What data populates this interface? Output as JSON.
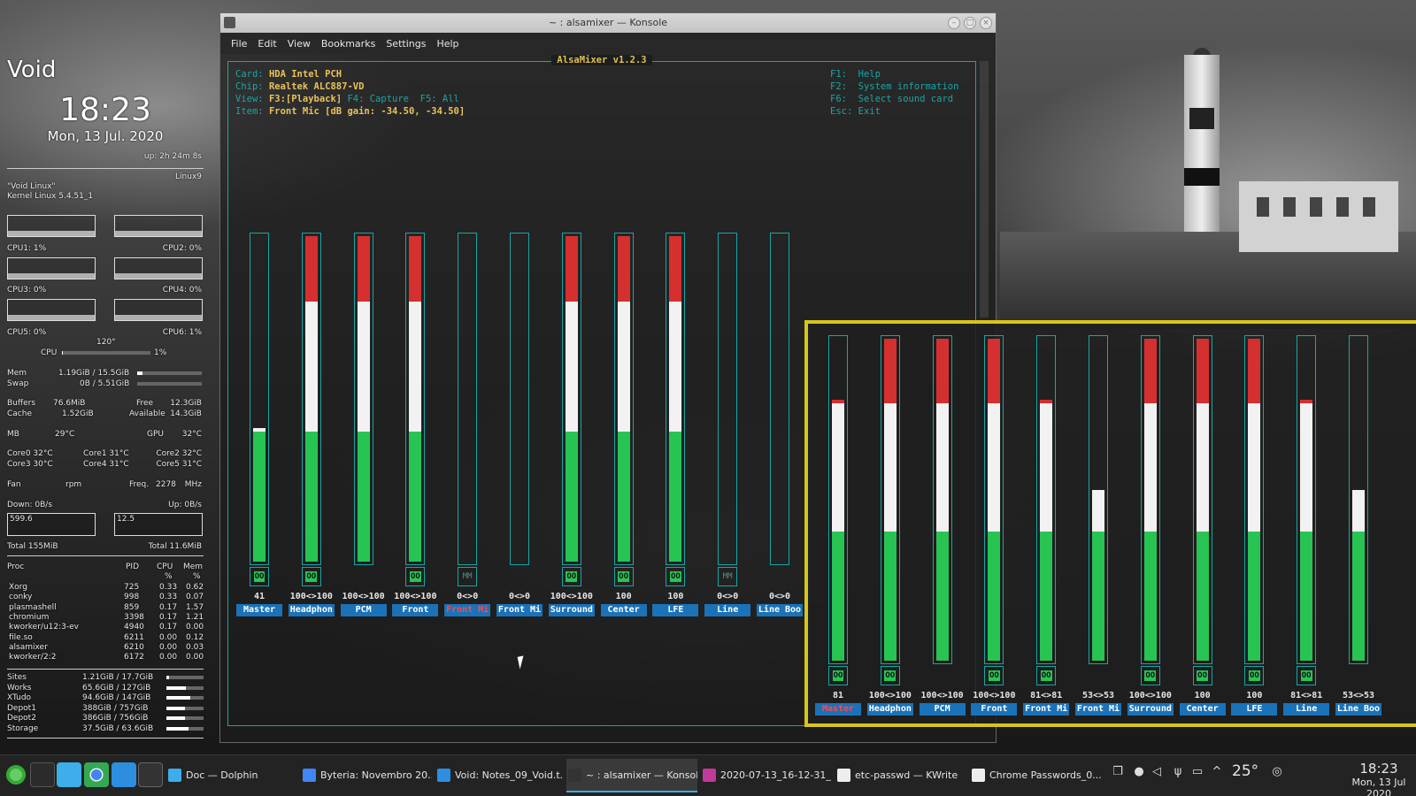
{
  "conky": {
    "hostname": "Void",
    "time": "18:23",
    "date": "Mon, 13 Jul. 2020",
    "uptime": "up: 2h 24m 8s",
    "kernel_short": "Linux9",
    "os": "\"Void Linux\"",
    "kernel": "Kernel Linux 5.4.51_1",
    "cpus": [
      {
        "label": "CPU1: 1%"
      },
      {
        "label": "CPU2: 0%"
      },
      {
        "label": "CPU3: 0%"
      },
      {
        "label": "CPU4: 0%"
      },
      {
        "label": "CPU5: 0%"
      },
      {
        "label": "CPU6: 1%"
      }
    ],
    "cpu_temp": "120°",
    "cpu_label": "CPU",
    "cpu_total": "1%",
    "cpu_total_fraction": 0.01,
    "mem_label": "Mem",
    "mem_value": "1.19GiB / 15.5GiB",
    "mem_fraction": 0.08,
    "swap_label": "Swap",
    "swap_value": "0B / 5.51GiB",
    "swap_fraction": 0,
    "buffers_label": "Buffers",
    "buffers": "76.6MiB",
    "free_label": "Free",
    "free": "12.3GiB",
    "cache_label": "Cache",
    "cache": "1.52GiB",
    "available_label": "Available",
    "available": "14.3GiB",
    "mb_label": "MB",
    "mb_temp": "29°C",
    "gpu_label": "GPU",
    "gpu_temp": "32°C",
    "cores": [
      "Core0 32°C",
      "Core1 31°C",
      "Core2 32°C",
      "Core3 30°C",
      "Core4 31°C",
      "Core5 31°C"
    ],
    "fan_label": "Fan",
    "fan_unit": "rpm",
    "freq_label": "Freq.",
    "freq": "2278",
    "freq_unit": "MHz",
    "down": "Down: 0B/s",
    "up": "Up: 0B/s",
    "down_peak": "599.6",
    "up_peak": "12.5",
    "total_down": "Total 155MiB",
    "total_up": "Total 11.6MiB",
    "proc_header": {
      "name": "Proc",
      "pid": "PID",
      "cpu": "CPU",
      "mem": "Mem",
      "cpu_unit": "%",
      "mem_unit": "%"
    },
    "procs": [
      {
        "name": "Xorg",
        "pid": "725",
        "cpu": "0.33",
        "mem": "0.62"
      },
      {
        "name": "conky",
        "pid": "998",
        "cpu": "0.33",
        "mem": "0.07"
      },
      {
        "name": "plasmashell",
        "pid": "859",
        "cpu": "0.17",
        "mem": "1.57"
      },
      {
        "name": "chromium",
        "pid": "3398",
        "cpu": "0.17",
        "mem": "1.21"
      },
      {
        "name": "kworker/u12:3-ev",
        "pid": "4940",
        "cpu": "0.17",
        "mem": "0.00"
      },
      {
        "name": "file.so",
        "pid": "6211",
        "cpu": "0.00",
        "mem": "0.12"
      },
      {
        "name": "alsamixer",
        "pid": "6210",
        "cpu": "0.00",
        "mem": "0.03"
      },
      {
        "name": "kworker/2:2",
        "pid": "6172",
        "cpu": "0.00",
        "mem": "0.00"
      }
    ],
    "disks": [
      {
        "name": "Sites",
        "value": "1.21GiB / 17.7GiB",
        "fraction": 0.07
      },
      {
        "name": "Works",
        "value": "65.6GiB / 127GiB",
        "fraction": 0.52
      },
      {
        "name": "XTudo",
        "value": "94.6GiB / 147GiB",
        "fraction": 0.64
      },
      {
        "name": "Depot1",
        "value": "388GiB / 757GiB",
        "fraction": 0.51
      },
      {
        "name": "Depot2",
        "value": "386GiB / 756GiB",
        "fraction": 0.51
      },
      {
        "name": "Storage",
        "value": "37.5GiB / 63.6GiB",
        "fraction": 0.59
      }
    ]
  },
  "window": {
    "title": "~ : alsamixer — Konsole",
    "menu": [
      "File",
      "Edit",
      "View",
      "Bookmarks",
      "Settings",
      "Help"
    ]
  },
  "alsamixer": {
    "title": "AlsaMixer v1.2.3",
    "info": [
      {
        "key": "Card:",
        "value": "HDA Intel PCH"
      },
      {
        "key": "Chip:",
        "value": "Realtek ALC887-VD"
      },
      {
        "key": "View:",
        "value": "F3:[Playback]",
        "rest": " F4: Capture  F5: All"
      },
      {
        "key": "Item:",
        "value": "Front Mic [dB gain: -34.50, -34.50]"
      }
    ],
    "help": [
      {
        "key": "F1:",
        "text": "Help"
      },
      {
        "key": "F2:",
        "text": "System information"
      },
      {
        "key": "F6:",
        "text": "Select sound card"
      },
      {
        "key": "Esc:",
        "text": "Exit"
      }
    ],
    "channels": [
      {
        "name": "Master",
        "value": "41",
        "level": 41,
        "mute": "OO",
        "selected": false
      },
      {
        "name": "Headphon",
        "value": "100<>100",
        "level": 100,
        "mute": "OO",
        "selected": false
      },
      {
        "name": "PCM",
        "value": "100<>100",
        "level": 100,
        "mute": "",
        "selected": false
      },
      {
        "name": "Front",
        "value": "100<>100",
        "level": 100,
        "mute": "OO",
        "selected": false
      },
      {
        "name": "Front Mi",
        "value": "0<>0",
        "level": 0,
        "mute": "MM",
        "selected": true
      },
      {
        "name": "Front Mi",
        "value": "0<>0",
        "level": 0,
        "mute": "",
        "selected": false
      },
      {
        "name": "Surround",
        "value": "100<>100",
        "level": 100,
        "mute": "OO",
        "selected": false
      },
      {
        "name": "Center",
        "value": "100",
        "level": 100,
        "mute": "OO",
        "selected": false
      },
      {
        "name": "LFE",
        "value": "100",
        "level": 100,
        "mute": "OO",
        "selected": false
      },
      {
        "name": "Line",
        "value": "0<>0",
        "level": 0,
        "mute": "MM",
        "selected": false
      },
      {
        "name": "Line Boo",
        "value": "0<>0",
        "level": 0,
        "mute": "",
        "selected": false
      }
    ],
    "zoom_channels": [
      {
        "name": "Master",
        "value": "81",
        "level": 81,
        "mute": "OO",
        "selected": true
      },
      {
        "name": "Headphon",
        "value": "100<>100",
        "level": 100,
        "mute": "OO",
        "selected": false
      },
      {
        "name": "PCM",
        "value": "100<>100",
        "level": 100,
        "mute": "",
        "selected": false
      },
      {
        "name": "Front",
        "value": "100<>100",
        "level": 100,
        "mute": "OO",
        "selected": false
      },
      {
        "name": "Front Mi",
        "value": "81<>81",
        "level": 81,
        "mute": "OO",
        "selected": false
      },
      {
        "name": "Front Mi",
        "value": "53<>53",
        "level": 53,
        "mute": "",
        "selected": false
      },
      {
        "name": "Surround",
        "value": "100<>100",
        "level": 100,
        "mute": "OO",
        "selected": false
      },
      {
        "name": "Center",
        "value": "100",
        "level": 100,
        "mute": "OO",
        "selected": false
      },
      {
        "name": "LFE",
        "value": "100",
        "level": 100,
        "mute": "OO",
        "selected": false
      },
      {
        "name": "Line",
        "value": "81<>81",
        "level": 81,
        "mute": "OO",
        "selected": false
      },
      {
        "name": "Line Boo",
        "value": "53<>53",
        "level": 53,
        "mute": "",
        "selected": false
      }
    ]
  },
  "taskbar": {
    "tasks": [
      {
        "label": "Doc — Dolphin",
        "color": "#3daee9",
        "active": false
      },
      {
        "label": "Byteria: Novembro 20...",
        "color": "#4285f4",
        "active": false
      },
      {
        "label": "Void: Notes_09_Void.t...",
        "color": "#2d8ee0",
        "active": false
      },
      {
        "label": "~ : alsamixer — Konsole",
        "color": "#333",
        "active": true
      },
      {
        "label": "2020-07-13_16-12-31_...",
        "color": "#c03a9a",
        "active": false
      },
      {
        "label": "etc-passwd — KWrite",
        "color": "#eee",
        "active": false
      },
      {
        "label": "Chrome Passwords_0...",
        "color": "#eee",
        "active": false
      }
    ],
    "temperature": "25°",
    "clock_time": "18:23",
    "clock_date": "Mon, 13 Jul 2020"
  },
  "colors": {
    "accent": "#1aa5a5",
    "volume_green": "#27c454",
    "volume_white": "#f2f2f2",
    "volume_red": "#d43030",
    "highlight_border": "#d8c51b",
    "channel_label_bg": "#1a72b8"
  }
}
